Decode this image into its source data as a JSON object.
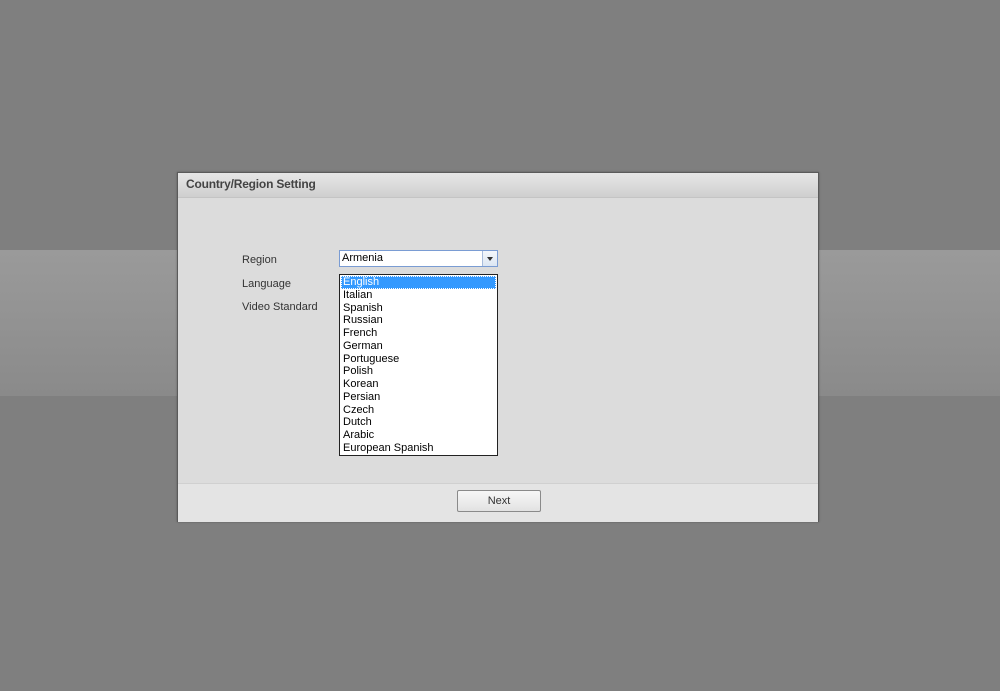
{
  "dialog": {
    "title": "Country/Region Setting"
  },
  "form": {
    "region_label": "Region",
    "language_label": "Language",
    "video_standard_label": "Video Standard",
    "region_value": "Armenia"
  },
  "language_dropdown": {
    "selected": "English",
    "options": [
      "English",
      "Italian",
      "Spanish",
      "Russian",
      "French",
      "German",
      "Portuguese",
      "Polish",
      "Korean",
      "Persian",
      "Czech",
      "Dutch",
      "Arabic",
      "European Spanish"
    ]
  },
  "footer": {
    "next_label": "Next"
  },
  "colors": {
    "background": "#7f7f7f",
    "dialog": "#dcdcdc",
    "selection": "#3399ff"
  }
}
